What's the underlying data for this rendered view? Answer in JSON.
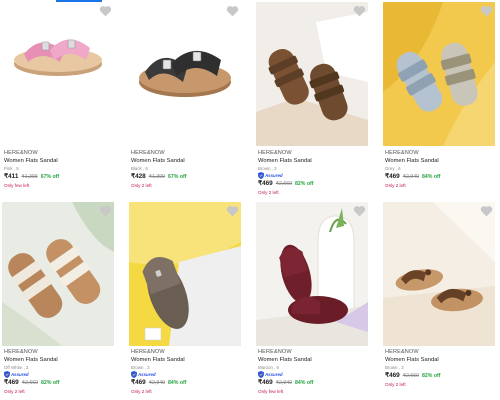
{
  "products": [
    {
      "brand": "HERE&NOW",
      "name": "Women Flats Sandal",
      "variant": "Pink , 5",
      "assured": false,
      "price": "₹411",
      "mrp": "₹1,399",
      "off": "67% off",
      "stock": "Only few left"
    },
    {
      "brand": "HERE&NOW",
      "name": "Women Flats Sandal",
      "variant": "Black , 6",
      "assured": false,
      "price": "₹428",
      "mrp": "₹1,399",
      "off": "67% off",
      "stock": "Only 2 left"
    },
    {
      "brand": "HERE&NOW",
      "name": "Women Flats Sandal",
      "variant": "Brown , 3",
      "assured": true,
      "price": "₹469",
      "mrp": "₹2,660",
      "off": "82% off",
      "stock": "Only 2 left"
    },
    {
      "brand": "HERE&NOW",
      "name": "Women Flats Sandal",
      "variant": "Grey , 6",
      "assured": false,
      "price": "₹469",
      "mrp": "₹2,949",
      "off": "84% off",
      "stock": "Only 2 left"
    },
    {
      "brand": "HERE&NOW",
      "name": "Women Flats Sandal",
      "variant": "Off White , 3",
      "assured": true,
      "price": "₹469",
      "mrp": "₹2,660",
      "off": "82% off",
      "stock": "Only 2 left"
    },
    {
      "brand": "HERE&NOW",
      "name": "Women Flats Sandal",
      "variant": "Brown , 3",
      "assured": true,
      "price": "₹469",
      "mrp": "₹2,949",
      "off": "84% off",
      "stock": "Only 2 left"
    },
    {
      "brand": "HERE&NOW",
      "name": "Women Flats Sandal",
      "variant": "Maroon , 6",
      "assured": true,
      "price": "₹469",
      "mrp": "₹2,949",
      "off": "84% off",
      "stock": "Only few left"
    },
    {
      "brand": "HERE&NOW",
      "name": "Women Flats Sandal",
      "variant": "Brown , 3",
      "assured": false,
      "price": "₹469",
      "mrp": "₹2,660",
      "off": "82% off",
      "stock": "Only 2 left"
    }
  ],
  "assured_label": "Assured",
  "icons": {
    "wishlist": "heart-icon",
    "assured": "shield-icon"
  },
  "colors": {
    "price": "#212121",
    "discount": "#26a541",
    "stock": "#c2185b",
    "assured": "#2a55e5",
    "wishlist": "#c8c8c8"
  }
}
